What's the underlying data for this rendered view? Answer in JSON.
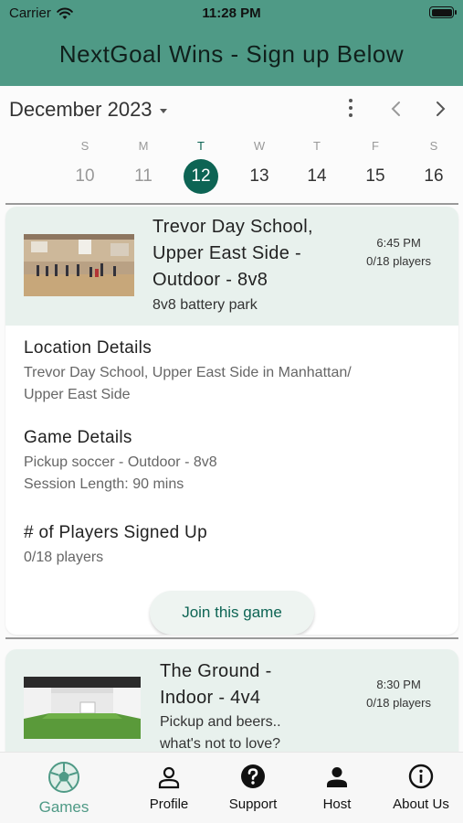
{
  "status_bar": {
    "carrier": "Carrier",
    "time": "11:28 PM"
  },
  "app_title": "NextGoal Wins - Sign up Below",
  "calendar": {
    "month": "December 2023",
    "days": [
      {
        "dow": "S",
        "num": "10",
        "state": "past"
      },
      {
        "dow": "M",
        "num": "11",
        "state": "past"
      },
      {
        "dow": "T",
        "num": "12",
        "state": "selected"
      },
      {
        "dow": "W",
        "num": "13",
        "state": "normal"
      },
      {
        "dow": "T",
        "num": "14",
        "state": "normal"
      },
      {
        "dow": "F",
        "num": "15",
        "state": "normal"
      },
      {
        "dow": "S",
        "num": "16",
        "state": "normal"
      }
    ]
  },
  "games": [
    {
      "venue": [
        "Trevor Day School,",
        "Upper East Side -",
        "Outdoor - 8v8"
      ],
      "description": "8v8 battery park",
      "time": "6:45 PM",
      "players": "0/18 players",
      "location_title": "Location Details",
      "location_text": [
        "Trevor Day School, Upper East Side in Manhattan/",
        "Upper East Side"
      ],
      "game_title": "Game Details",
      "game_text": [
        "Pickup soccer - Outdoor - 8v8",
        "Session Length: 90 mins"
      ],
      "signed_title": "# of Players Signed Up",
      "signed_text": "0/18 players",
      "join_label": "Join this game"
    },
    {
      "venue": [
        "The Ground -",
        "Indoor - 4v4"
      ],
      "description": [
        "Pickup and beers..",
        "what's not to love?"
      ],
      "time": "8:30 PM",
      "players": "0/18 players"
    }
  ],
  "tabs": [
    {
      "label": "Games",
      "icon": "soccer-ball-icon",
      "active": true
    },
    {
      "label": "Profile",
      "icon": "person-outline-icon",
      "active": false
    },
    {
      "label": "Support",
      "icon": "question-circle-icon",
      "active": false
    },
    {
      "label": "Host",
      "icon": "person-filled-icon",
      "active": false
    },
    {
      "label": "About Us",
      "icon": "info-circle-icon",
      "active": false
    }
  ],
  "colors": {
    "header": "#4f9a86",
    "accent": "#0d6454",
    "card_head": "#e8f1ed"
  }
}
